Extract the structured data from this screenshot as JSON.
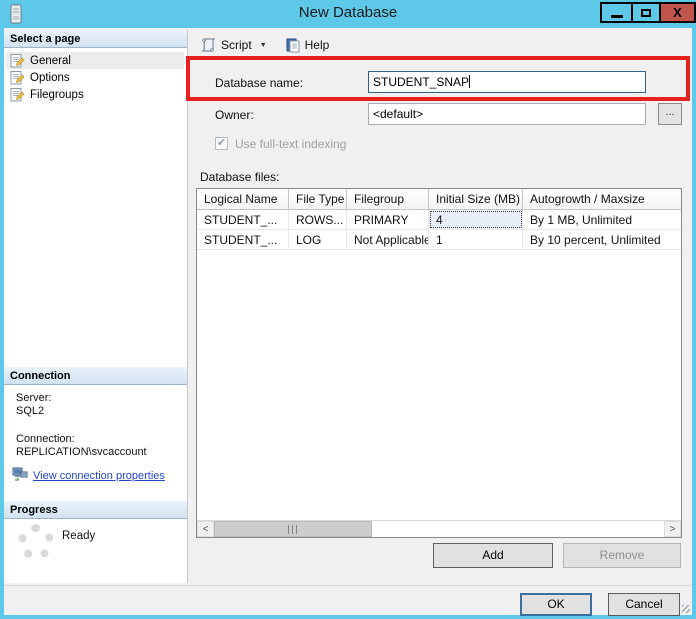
{
  "window": {
    "title": "New Database",
    "controls": {
      "close_glyph": "X"
    }
  },
  "icons": {
    "check": "✔",
    "dropdown_arrow": "▼",
    "scroll_left": "<",
    "scroll_right": ">",
    "browse_dots": "..."
  },
  "colors": {
    "titlebar_blue": "#5EC8E8",
    "close_red": "#C0564B",
    "annotation_red": "#E6201F",
    "link_blue": "#2145CD",
    "focused_cell_bg": "#E7EEF8"
  },
  "sidebar": {
    "pages_header": "Select a page",
    "pages": [
      {
        "label": "General"
      },
      {
        "label": "Options"
      },
      {
        "label": "Filegroups"
      }
    ],
    "connection": {
      "header": "Connection",
      "server_label": "Server:",
      "server_value": "SQL2",
      "connection_label": "Connection:",
      "connection_value": "REPLICATION\\svcaccount",
      "link_label": "View connection properties"
    },
    "progress": {
      "header": "Progress",
      "status": "Ready"
    }
  },
  "toolbar": {
    "script_label": "Script",
    "help_label": "Help"
  },
  "form": {
    "database_name_label": "Database name:",
    "database_name_value": "STUDENT_SNAP",
    "owner_label": "Owner:",
    "owner_value": "<default>",
    "fulltext_label": "Use full-text indexing",
    "files_label": "Database files:"
  },
  "grid": {
    "columns": [
      "Logical Name",
      "File Type",
      "Filegroup",
      "Initial Size (MB)",
      "Autogrowth / Maxsize"
    ],
    "rows": [
      [
        "STUDENT_...",
        "ROWS...",
        "PRIMARY",
        "4",
        "By 1 MB, Unlimited"
      ],
      [
        "STUDENT_...",
        "LOG",
        "Not Applicable",
        "1",
        "By 10 percent, Unlimited"
      ]
    ]
  },
  "buttons": {
    "add": "Add",
    "remove": "Remove",
    "ok": "OK",
    "cancel": "Cancel"
  }
}
